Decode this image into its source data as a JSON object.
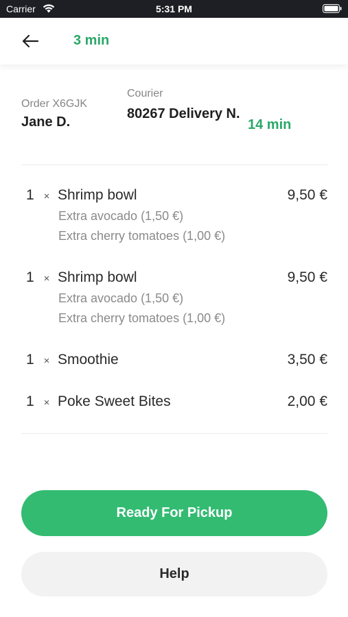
{
  "status_bar": {
    "carrier": "Carrier",
    "time": "5:31 PM"
  },
  "header": {
    "time": "3 min"
  },
  "order": {
    "label": "Order X6GJK",
    "customer": "Jane D."
  },
  "courier": {
    "label": "Courier",
    "name": "80267 Delivery N.",
    "eta": "14 min"
  },
  "items": [
    {
      "qty": "1",
      "times": "×",
      "name": "Shrimp bowl",
      "price": "9,50 €",
      "extras": [
        "Extra avocado (1,50 €)",
        "Extra cherry tomatoes (1,00 €)"
      ]
    },
    {
      "qty": "1",
      "times": "×",
      "name": "Shrimp bowl",
      "price": "9,50 €",
      "extras": [
        "Extra avocado (1,50 €)",
        "Extra cherry tomatoes (1,00 €)"
      ]
    },
    {
      "qty": "1",
      "times": "×",
      "name": "Smoothie",
      "price": "3,50 €",
      "extras": []
    },
    {
      "qty": "1",
      "times": "×",
      "name": "Poke Sweet Bites",
      "price": "2,00 €",
      "extras": []
    }
  ],
  "actions": {
    "ready_label": "Ready For Pickup",
    "help_label": "Help"
  },
  "colors": {
    "accent": "#33bb72",
    "accent_text": "#2aa869",
    "status_bar": "#1e1f24"
  },
  "icons": {
    "back": "arrow-left-icon",
    "wifi": "wifi-icon",
    "battery": "battery-icon"
  }
}
